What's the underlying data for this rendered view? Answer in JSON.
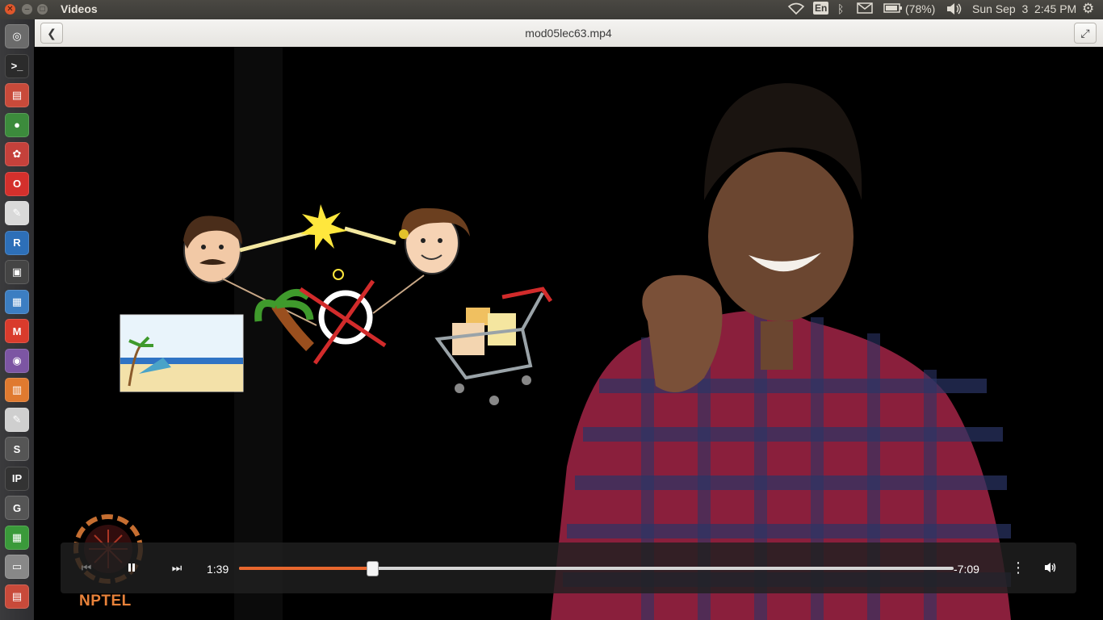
{
  "top_panel": {
    "app_title": "Videos",
    "keyboard_layout": "En",
    "battery_percent": "(78%)",
    "datetime": "Sun Sep  3  2:45 PM"
  },
  "header": {
    "file_title": "mod05lec63.mp4"
  },
  "launcher": {
    "items": [
      {
        "name": "dash-home",
        "glyph": "◎",
        "color": "#6b6b6b"
      },
      {
        "name": "terminal",
        "glyph": ">_",
        "color": "#2b2b2b"
      },
      {
        "name": "file-manager",
        "glyph": "▤",
        "color": "#c84a3a"
      },
      {
        "name": "chrome",
        "glyph": "●",
        "color": "#3c8b3c"
      },
      {
        "name": "software-center",
        "glyph": "✿",
        "color": "#c5413b"
      },
      {
        "name": "opera",
        "glyph": "O",
        "color": "#d4302c"
      },
      {
        "name": "document-viewer",
        "glyph": "✎",
        "color": "#d9d9d9"
      },
      {
        "name": "r-language",
        "glyph": "R",
        "color": "#2d6fb8"
      },
      {
        "name": "video-editor",
        "glyph": "▣",
        "color": "#444"
      },
      {
        "name": "writer",
        "glyph": "▦",
        "color": "#3c7ec2"
      },
      {
        "name": "gmail",
        "glyph": "M",
        "color": "#d93b2c"
      },
      {
        "name": "media-player",
        "glyph": "◉",
        "color": "#7c55a3"
      },
      {
        "name": "impress",
        "glyph": "▥",
        "color": "#e07a2f"
      },
      {
        "name": "text-editor",
        "glyph": "✎",
        "color": "#cfcfcf"
      },
      {
        "name": "sublime",
        "glyph": "S",
        "color": "#555"
      },
      {
        "name": "ipython",
        "glyph": "IP",
        "color": "#333"
      },
      {
        "name": "geogebra",
        "glyph": "G",
        "color": "#555"
      },
      {
        "name": "calc",
        "glyph": "▦",
        "color": "#3a9a3a"
      },
      {
        "name": "drive",
        "glyph": "▭",
        "color": "#888"
      },
      {
        "name": "archive",
        "glyph": "▤",
        "color": "#c84a3a"
      }
    ]
  },
  "video": {
    "watermark_label": "NPTEL"
  },
  "controls": {
    "time_elapsed": "1:39",
    "time_remaining": "-7:09",
    "progress_fraction": 0.186
  }
}
